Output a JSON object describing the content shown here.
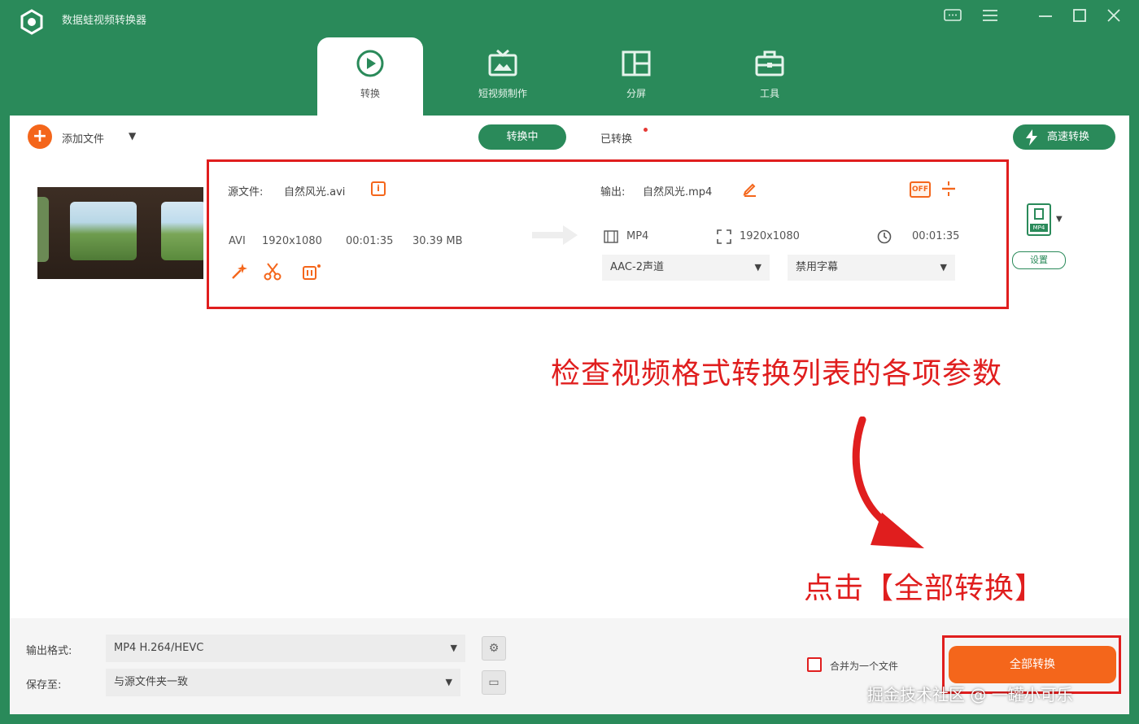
{
  "app": {
    "title": "数据蛙视频转换器",
    "window_controls": [
      "feedback-icon",
      "menu-icon",
      "minimize-icon",
      "maximize-icon",
      "close-icon"
    ]
  },
  "tabs": [
    {
      "label": "转换",
      "icon": "convert-icon",
      "active": true
    },
    {
      "label": "短视频制作",
      "icon": "tv-icon",
      "active": false
    },
    {
      "label": "分屏",
      "icon": "split-screen-icon",
      "active": false
    },
    {
      "label": "工具",
      "icon": "toolbox-icon",
      "active": false
    }
  ],
  "toolbar": {
    "add_file_label": "添加文件",
    "status_tabs": [
      {
        "label": "转换中",
        "active": true
      },
      {
        "label": "已转换",
        "active": false
      }
    ],
    "fast_convert_label": "高速转换"
  },
  "item": {
    "source": {
      "label": "源文件:",
      "filename": "自然风光.avi",
      "format": "AVI",
      "resolution": "1920x1080",
      "duration": "00:01:35",
      "size": "30.39 MB"
    },
    "output": {
      "label": "输出:",
      "filename": "自然风光.mp4",
      "format": "MP4",
      "resolution": "1920x1080",
      "duration": "00:01:35",
      "badge": "OFF",
      "audio_option": "AAC-2声道",
      "subtitle_option": "禁用字幕"
    },
    "tool_icons": [
      "enhance-icon",
      "cut-icon",
      "edit-effects-icon"
    ]
  },
  "side": {
    "format_icon_text": "MP4",
    "settings_label": "设置"
  },
  "annotations": {
    "check_text": "检查视频格式转换列表的各项参数",
    "click_text": "点击【全部转换】"
  },
  "bottom": {
    "output_format_label": "输出格式:",
    "output_format_value": "MP4 H.264/HEVC",
    "save_to_label": "保存至:",
    "save_to_value": "与源文件夹一致",
    "merge_label": "合并为一个文件",
    "convert_all_label": "全部转换"
  },
  "watermark": "掘金技术社区 @ 一罐小可乐",
  "colors": {
    "brand_green": "#2a8a5a",
    "accent_orange": "#f4661b",
    "annotation_red": "#e01e1e"
  }
}
